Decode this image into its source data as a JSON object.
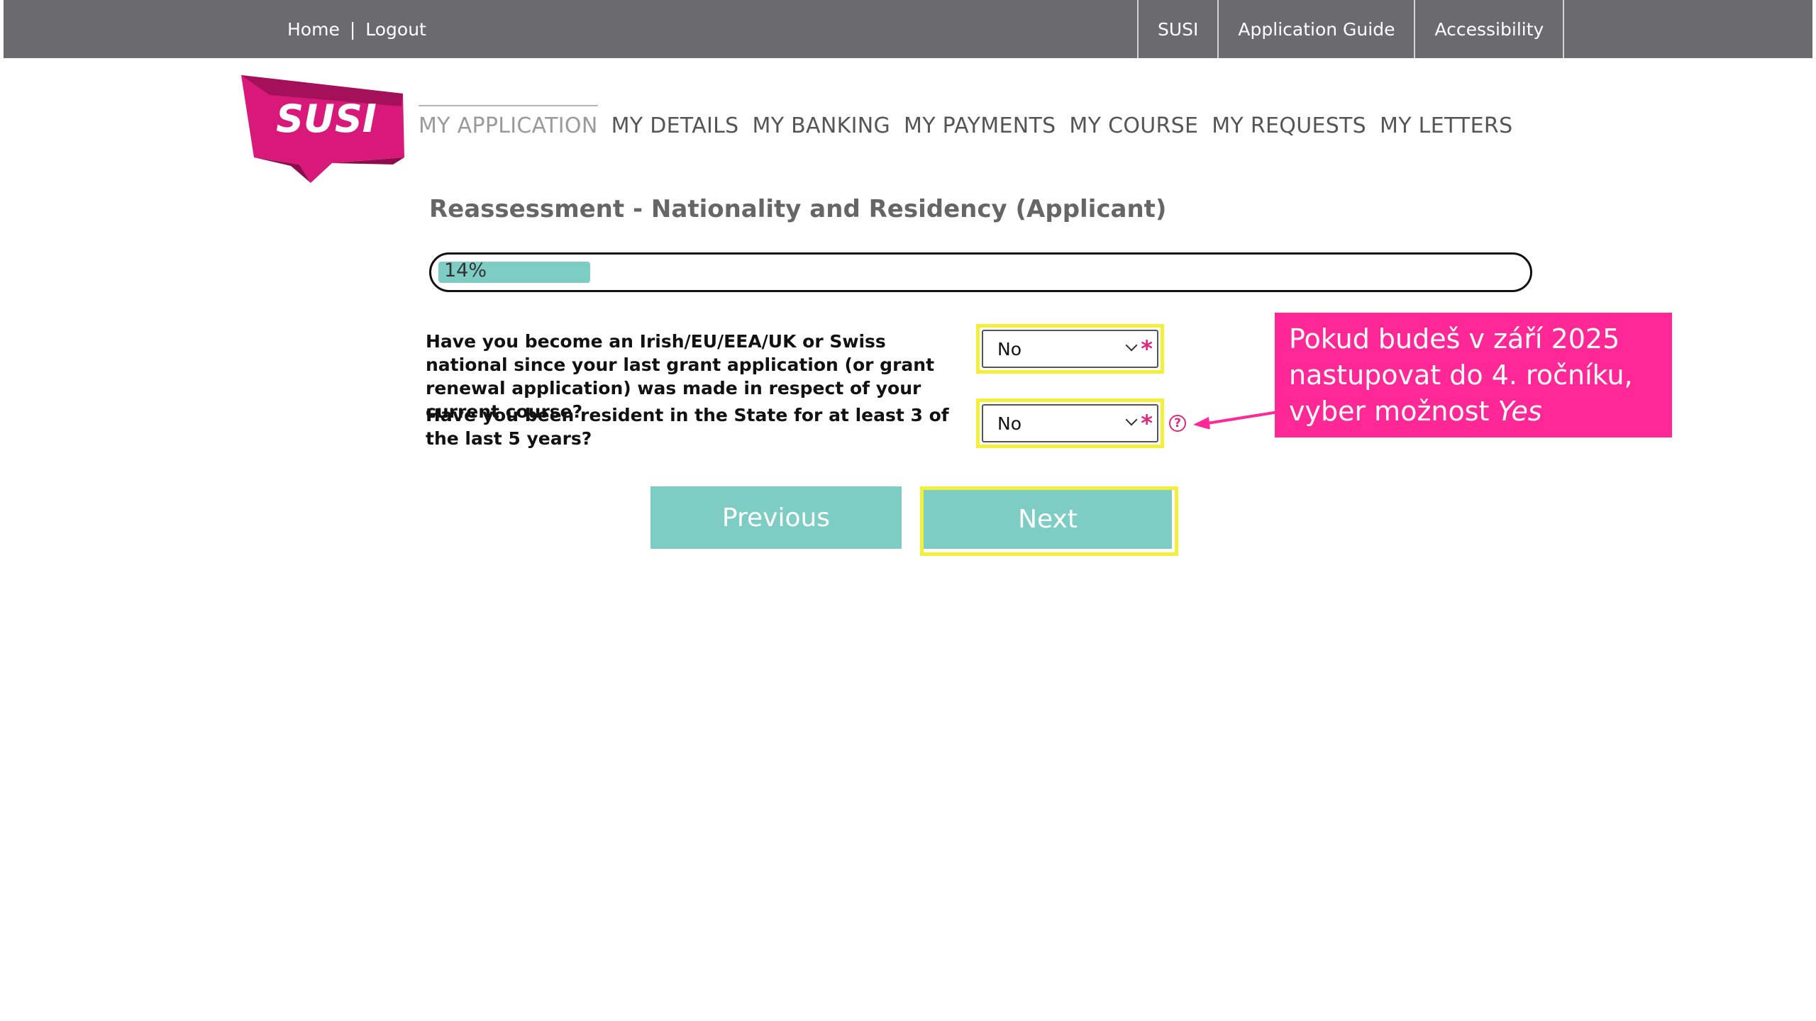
{
  "topbar": {
    "home": "Home",
    "separator": "|",
    "logout": "Logout",
    "links": [
      "SUSI",
      "Application Guide",
      "Accessibility"
    ]
  },
  "logo": {
    "text": "SUSI"
  },
  "nav": {
    "tabs": [
      "MY APPLICATION",
      "MY DETAILS",
      "MY BANKING",
      "MY PAYMENTS",
      "MY COURSE",
      "MY REQUESTS",
      "MY LETTERS"
    ],
    "active": "MY APPLICATION"
  },
  "page": {
    "title": "Reassessment - Nationality and Residency (Applicant)"
  },
  "progress": {
    "label": "14%",
    "value": 0.14
  },
  "questions": [
    {
      "text": "Have you become an Irish/EU/EEA/UK or Swiss national since your last grant application (or grant renewal application) was made in respect of your current course?",
      "value": "No",
      "required": "*"
    },
    {
      "text": "Have you been resident in the State for at least 3 of the last 5 years?",
      "value": "No",
      "required": "*",
      "help": "?"
    }
  ],
  "buttons": {
    "previous": "Previous",
    "next": "Next"
  },
  "callout": {
    "line1": "Pokud budeš v září 2025",
    "line2": "nastupovat do 4. ročníku,",
    "line3_prefix": "vyber možnost ",
    "line3_emph": "Yes"
  },
  "colors": {
    "topbar": "#6b6b6e",
    "accent": "#e0287d",
    "button": "#7dcdc5",
    "highlight": "#f4f03a",
    "callout": "#ff2896"
  }
}
